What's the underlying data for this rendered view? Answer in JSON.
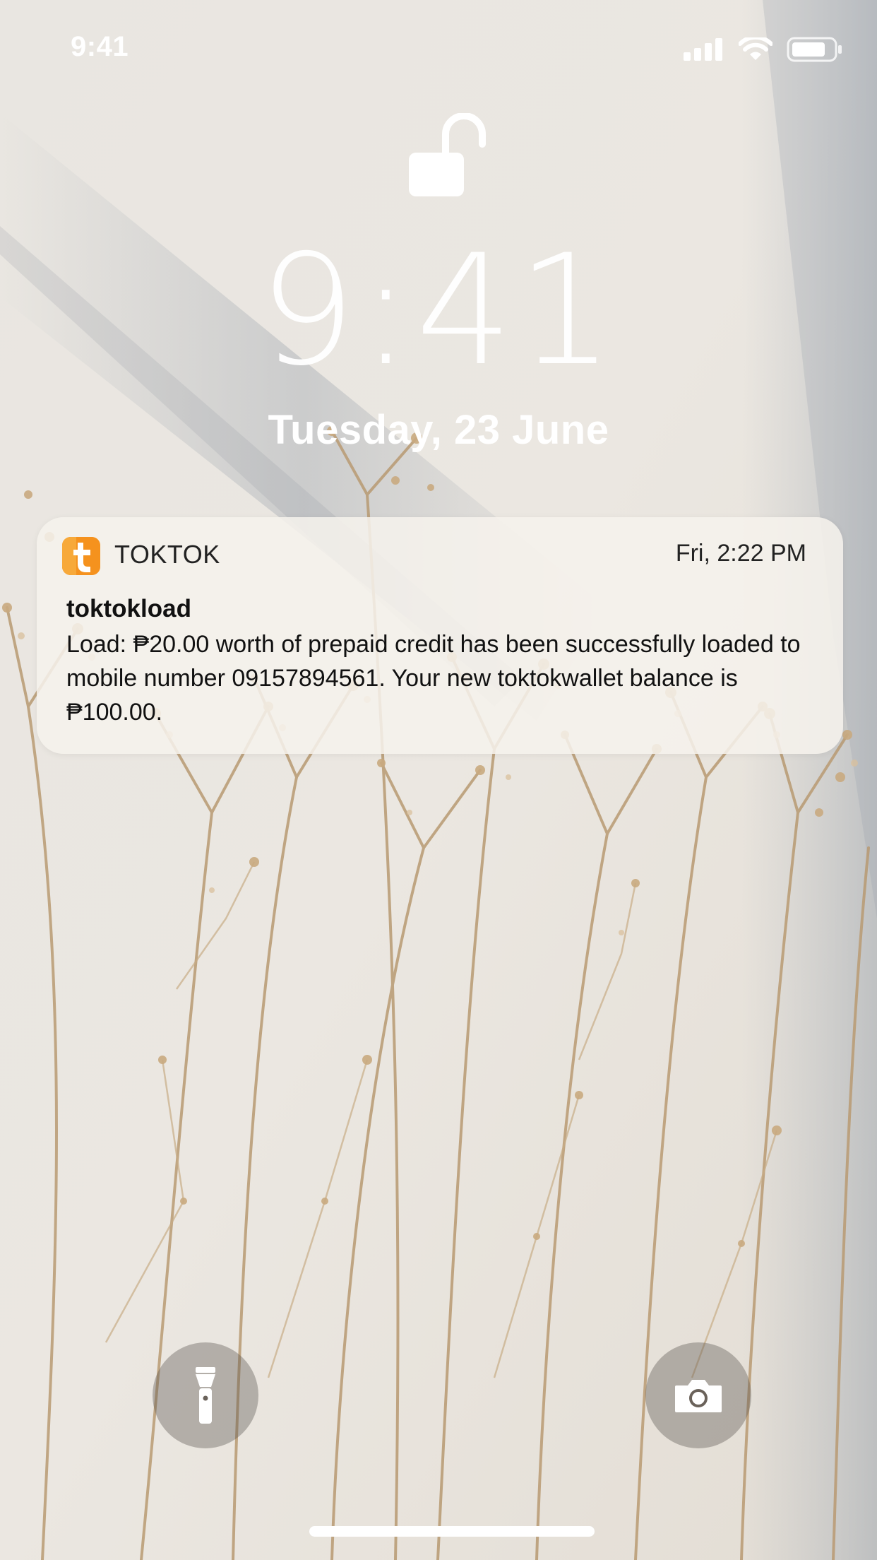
{
  "status_bar": {
    "time": "9:41",
    "icons": [
      "cellular-signal-icon",
      "wifi-icon",
      "battery-icon"
    ]
  },
  "lock_screen": {
    "lock_icon": "unlocked-padlock-icon",
    "time": "9:41",
    "date": "Tuesday, 23 June"
  },
  "notification": {
    "app_name": "TOKTOK",
    "app_icon": "toktok-app-icon",
    "app_icon_letter": "t",
    "timestamp": "Fri, 2:22 PM",
    "title": "toktokload",
    "body": "Load: ₱20.00 worth of prepaid credit has been successfully loaded to mobile number 09157894561. Your new toktokwallet balance is ₱100.00."
  },
  "quick_actions": {
    "left": "flashlight-icon",
    "right": "camera-icon"
  },
  "colors": {
    "brand_orange": "#f5921e",
    "notification_bg": "#f6f2ec",
    "text_dark": "#111111"
  }
}
